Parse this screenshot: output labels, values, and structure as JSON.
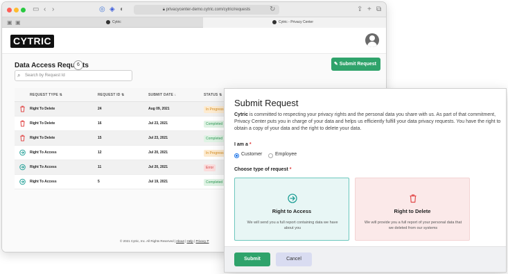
{
  "browser": {
    "url": "privacycenter-demo.cytric.com/cytric/requests",
    "tabs": [
      "Cytric",
      "Cytric - Privacy Center"
    ],
    "icons": [
      "sidebar-toggle-icon",
      "back-icon",
      "forward-icon",
      "shield-icon",
      "reload-icon",
      "share-icon",
      "new-tab-icon",
      "tabs-overview-icon"
    ]
  },
  "header": {
    "logo": "CYTRIC"
  },
  "page": {
    "title": "Data Access Requests",
    "count": "6",
    "submit_label": "Submit Request",
    "search_placeholder": "Search by Request Id"
  },
  "table": {
    "headers": [
      "REQUEST TYPE",
      "REQUEST ID",
      "SUBMIT DATE",
      "STATUS"
    ],
    "sort_glyphs": {
      "type": "⇅",
      "id": "⇅",
      "date": "↓",
      "status": "⇅"
    },
    "rows": [
      {
        "type": "Right To Delete",
        "id": "24",
        "date": "Aug 09, 2021",
        "status": "In Progress",
        "kind": "delete"
      },
      {
        "type": "Right To Delete",
        "id": "16",
        "date": "Jul 23, 2021",
        "status": "Completed",
        "kind": "delete"
      },
      {
        "type": "Right To Delete",
        "id": "15",
        "date": "Jul 23, 2021",
        "status": "Completed",
        "kind": "delete"
      },
      {
        "type": "Right To Access",
        "id": "12",
        "date": "Jul 20, 2021",
        "status": "In Progress",
        "kind": "access"
      },
      {
        "type": "Right To Access",
        "id": "11",
        "date": "Jul 20, 2021",
        "status": "Error",
        "kind": "access"
      },
      {
        "type": "Right To Access",
        "id": "5",
        "date": "Jul 19, 2021",
        "status": "Completed",
        "kind": "access"
      }
    ]
  },
  "footer": {
    "copyright": "© 2021 Cytric, Inc. All Rights Reserved |",
    "links": [
      "About",
      "Help",
      "Privacy P"
    ]
  },
  "modal": {
    "title": "Submit Request",
    "desc_brand": "Cytric",
    "desc_rest": " is committed to respecting your privacy rights and the personal data you share with us. As part of that commitment, Privacy Center puts you in charge of your data and helps us efficiently fulfill your data privacy requests. You have the right to obtain a copy of your data and the right to delete your data.",
    "iam_label": "I am a",
    "required_mark": "*",
    "options": [
      "Customer",
      "Employee"
    ],
    "choose_label": "Choose type of request",
    "access_title": "Right to Access",
    "access_desc": "We will send you a full report containing data we have about you",
    "delete_title": "Right to Delete",
    "delete_desc": "We will provide you a full report of your personal data that we deleted from our systems",
    "submit": "Submit",
    "cancel": "Cancel"
  },
  "colors": {
    "accent_green": "#2fa36b",
    "in_progress_bg": "#fdebd0",
    "in_progress_fg": "#d48a1a",
    "completed_bg": "#dff3e4",
    "completed_fg": "#2f9a56",
    "error_bg": "#fbdcdc",
    "error_fg": "#d13b3b",
    "delete_red": "#e24a4a",
    "access_teal": "#1f9f96"
  }
}
